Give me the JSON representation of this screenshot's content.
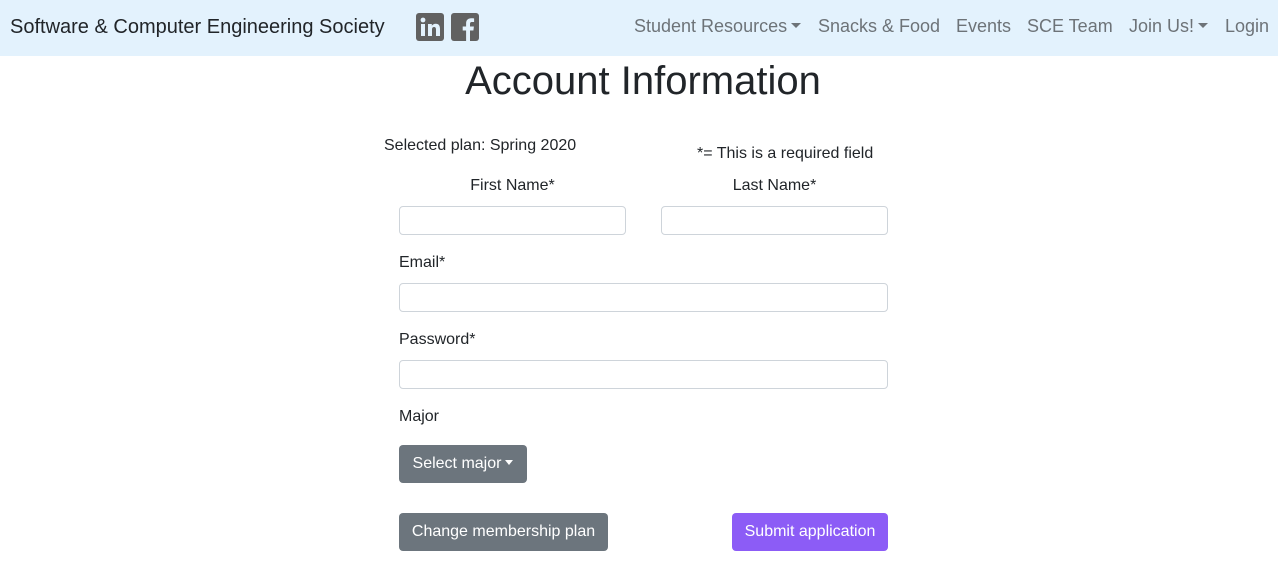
{
  "navbar": {
    "brand": "Software & Computer Engineering Society",
    "social": [
      {
        "name": "linkedin-icon"
      },
      {
        "name": "facebook-icon"
      }
    ],
    "items": [
      {
        "label": "Student Resources",
        "dropdown": true
      },
      {
        "label": "Snacks & Food",
        "dropdown": false
      },
      {
        "label": "Events",
        "dropdown": false
      },
      {
        "label": "SCE Team",
        "dropdown": false
      },
      {
        "label": "Join Us!",
        "dropdown": true
      },
      {
        "label": "Login",
        "dropdown": false
      }
    ],
    "background_color": "#e3f2fd"
  },
  "page": {
    "title": "Account Information",
    "selected_plan": "Selected plan: Spring 2020",
    "required_note": "*= This is a required field"
  },
  "form": {
    "first_name": {
      "label": "First Name*",
      "value": "",
      "placeholder": ""
    },
    "last_name": {
      "label": "Last Name*",
      "value": "",
      "placeholder": ""
    },
    "email": {
      "label": "Email*",
      "value": "",
      "placeholder": ""
    },
    "password": {
      "label": "Password*",
      "value": "",
      "placeholder": ""
    },
    "major": {
      "label": "Major",
      "button_label": "Select major"
    }
  },
  "actions": {
    "change_plan": "Change membership plan",
    "submit": "Submit application"
  },
  "colors": {
    "secondary_button": "#6c757d",
    "submit_button": "#8c5cf6",
    "nav_link": "#6d7378",
    "social_icon": "#616161"
  }
}
